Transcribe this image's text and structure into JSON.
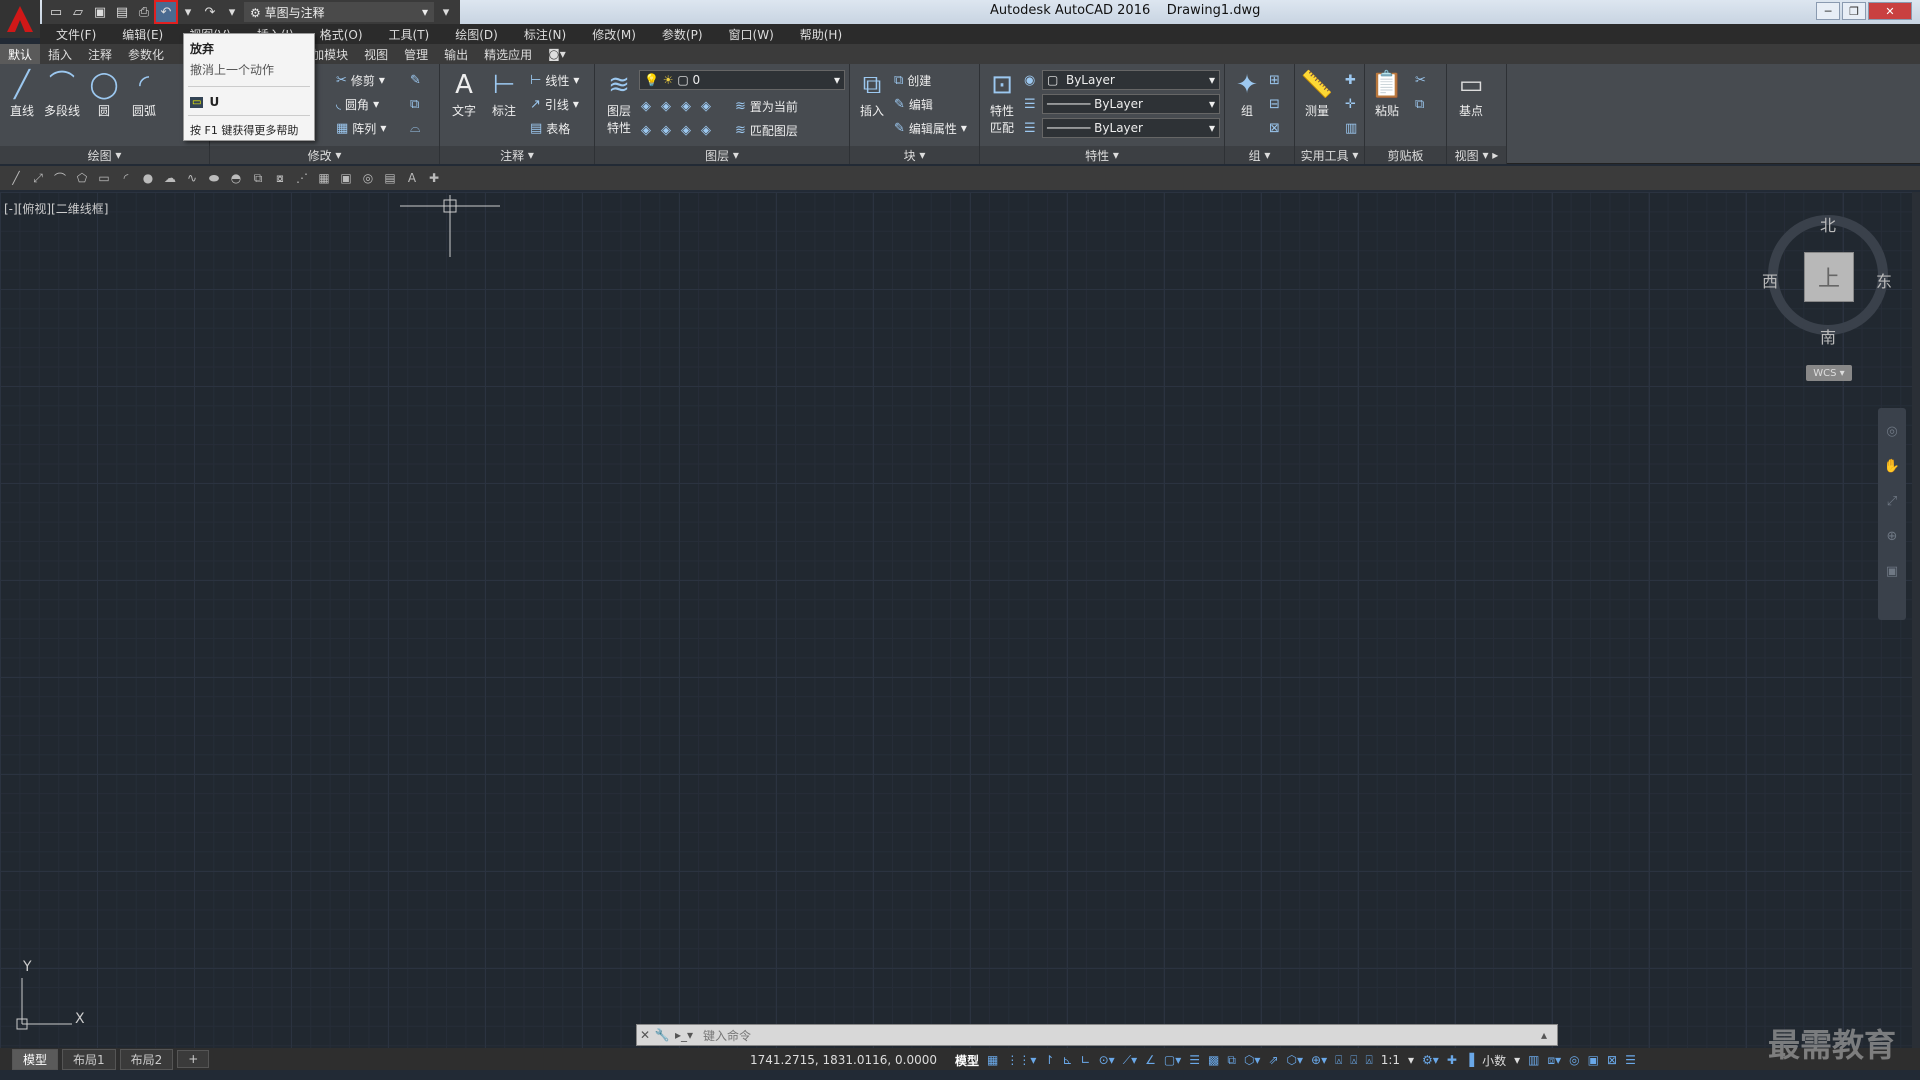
{
  "window": {
    "title": "Autodesk AutoCAD 2016",
    "filename": "Drawing1.dwg"
  },
  "workspace": "草图与注释",
  "menu": [
    "文件(F)",
    "编辑(E)",
    "视图(V)",
    "插入(I)",
    "格式(O)",
    "工具(T)",
    "绘图(D)",
    "标注(N)",
    "修改(M)",
    "参数(P)",
    "窗口(W)",
    "帮助(H)"
  ],
  "tabs": [
    "默认",
    "插入",
    "注释",
    "参数化",
    "视图",
    "管理",
    "输出",
    "附加模块",
    "视图",
    "管理",
    "输出",
    "精选应用"
  ],
  "dropdown": {
    "title": "放弃",
    "desc": "撤消上一个动作",
    "cmd": "U",
    "help": "按 F1 键获得更多帮助"
  },
  "draw": {
    "line": "直线",
    "polyline": "多段线",
    "circle": "圆",
    "arc": "圆弧",
    "panel": "绘图"
  },
  "modify": {
    "trim": "修剪",
    "fillet": "圆角",
    "array": "阵列",
    "panel": "修改"
  },
  "annot": {
    "text": "文字",
    "dim": "标注",
    "linear": "线性",
    "leader": "引线",
    "table": "表格",
    "panel": "注释"
  },
  "layers": {
    "props_top": "图层",
    "props_bottom": "特性",
    "current": "0",
    "set_current": "置为当前",
    "match": "匹配图层",
    "panel": "图层"
  },
  "block": {
    "insert": "插入",
    "create": "创建",
    "edit": "编辑",
    "edit_attr": "编辑属性",
    "panel": "块"
  },
  "props": {
    "match_top": "特性",
    "match_bottom": "匹配",
    "color": "ByLayer",
    "linetype": "ByLayer",
    "lineweight": "ByLayer",
    "panel": "特性"
  },
  "groups": {
    "group": "组",
    "panel": "组"
  },
  "utilities": {
    "measure": "测量",
    "panel": "实用工具"
  },
  "clipboard": {
    "paste": "粘贴",
    "panel": "剪贴板"
  },
  "view": {
    "base": "基点",
    "panel": "视图"
  },
  "viewport_label": "[-][俯视][二维线框]",
  "compass": {
    "n": "北",
    "s": "南",
    "e": "东",
    "w": "西",
    "top": "上",
    "wcs": "WCS"
  },
  "ucs": {
    "x": "X",
    "y": "Y"
  },
  "command": {
    "placeholder": "键入命令"
  },
  "layout_tabs": [
    "模型",
    "布局1",
    "布局2"
  ],
  "status": {
    "coords": "1741.2715, 1831.0116, 0.0000",
    "model": "模型",
    "scale": "1:1",
    "units": "小数"
  },
  "watermark": "最需教育"
}
